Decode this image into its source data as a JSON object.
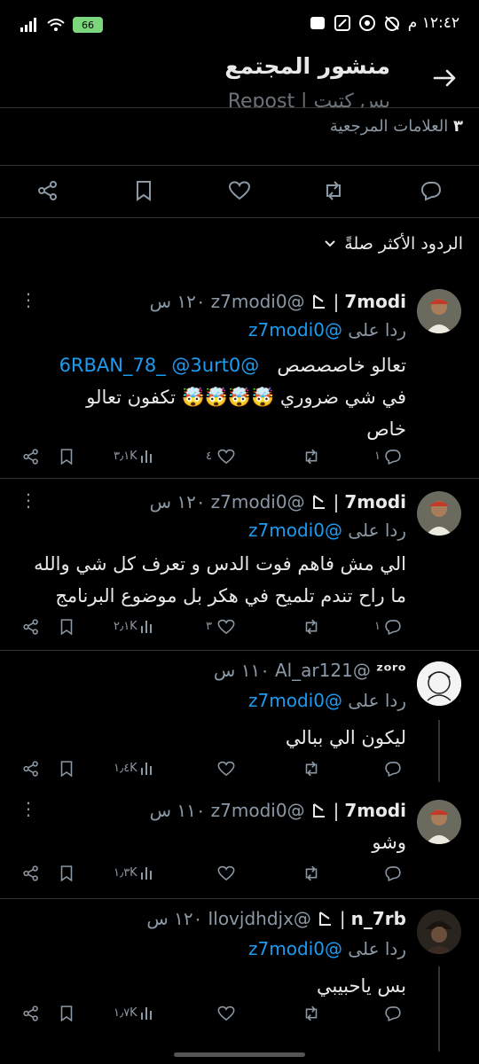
{
  "status_bar": {
    "time": "١٢:٤٢ م",
    "battery": "66",
    "icons": [
      "alarm-off-icon",
      "whatsapp-icon",
      "translate-icon",
      "message-icon",
      "battery-icon",
      "wifi-icon",
      "signal-icon"
    ]
  },
  "header": {
    "title": "منشور المجتمع",
    "subtitle": "Repost | بس كتبت",
    "back_icon": "arrow-right-icon"
  },
  "bookmarks": {
    "count": "٣",
    "label": "العلامات المرجعية"
  },
  "actions": [
    "reply-icon",
    "retweet-icon",
    "like-icon",
    "bookmark-icon",
    "share-icon"
  ],
  "sort": {
    "label": "الردود الأكثر صلةً",
    "icon": "chevron-down-icon"
  },
  "replies": [
    {
      "name": "7modi",
      "handle": "@z7modi0",
      "time": "١٢٠ س",
      "replying_label": "ردا على",
      "replying_to": "@z7modi0",
      "mentions": "@6RBAN_78_ @3urt0",
      "text_1": "تعالو خاصصصص",
      "text_2": "في شي ضروري 🤯🤯🤯🤯 تكفون تعالو",
      "text_3": "خاص",
      "replies_count": "١",
      "retweets_count": "",
      "likes_count": "٤",
      "views_count": "٣٫١K"
    },
    {
      "name": "7modi",
      "handle": "@z7modi0",
      "time": "١٢٠ س",
      "replying_label": "ردا على",
      "replying_to": "@z7modi0",
      "text_1": "الي مش فاهم فوت الدس و تعرف كل شي والله",
      "text_2": "ما راح تندم تلميح في هكر بل موضوع البرنامج",
      "replies_count": "١",
      "retweets_count": "",
      "likes_count": "٣",
      "views_count": "٢٫١K"
    },
    {
      "name": "ᶻᵒʳᵒ",
      "handle": "@Al_ar121",
      "time": "١١٠ س",
      "replying_label": "ردا على",
      "replying_to": "@z7modi0",
      "text_1": "ليكون الي ببالي",
      "replies_count": "",
      "retweets_count": "",
      "likes_count": "",
      "views_count": "١٫٤K"
    },
    {
      "name": "7modi",
      "handle": "@z7modi0",
      "time": "١١٠ س",
      "text_1": "وشو",
      "replies_count": "",
      "retweets_count": "",
      "likes_count": "",
      "views_count": "١٫٣K"
    },
    {
      "name": "n_7rb",
      "handle": "@Ilovjdhdjx",
      "time": "١٢٠ س",
      "replying_label": "ردا على",
      "replying_to": "@z7modi0",
      "text_1": "بس ياحبيبي",
      "replies_count": "",
      "retweets_count": "",
      "likes_count": "",
      "views_count": "١٫٧K"
    }
  ],
  "colors": {
    "background": "#000000",
    "text": "#e7e9ea",
    "muted": "#8b98a5",
    "accent": "#1d9bf0",
    "divider": "#2f3336"
  }
}
